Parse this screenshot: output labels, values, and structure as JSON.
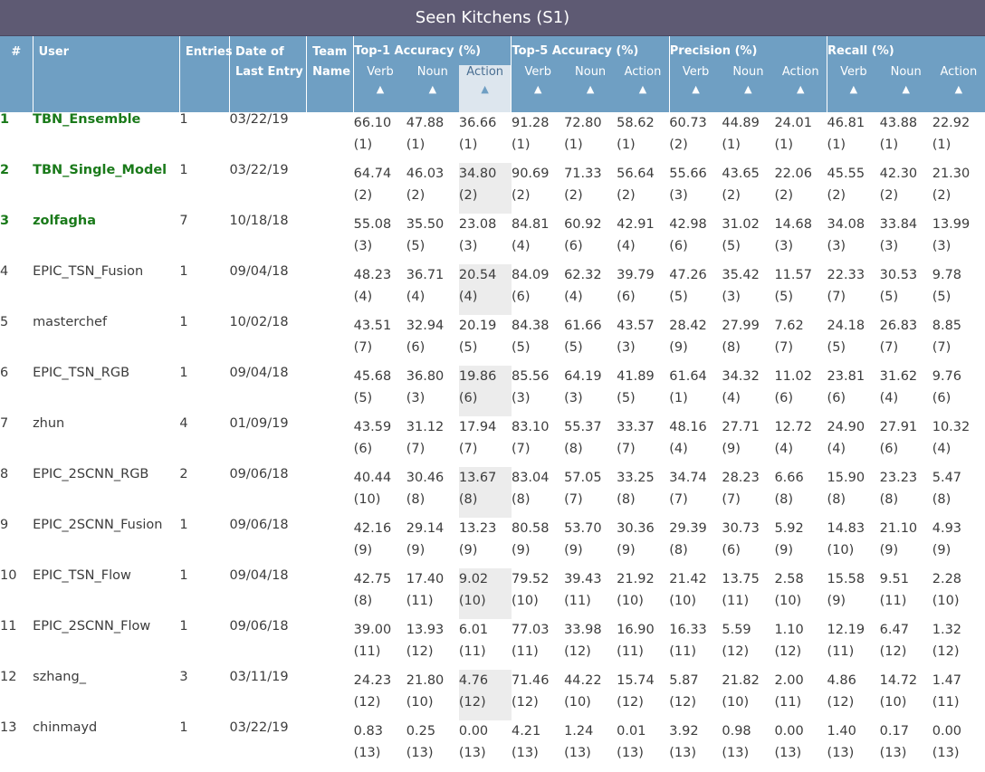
{
  "title": "Seen Kitchens (S1)",
  "colors": {
    "title_bg": "#5e5a73",
    "header_bg": "#6f9fc3",
    "top_rank": "#1a7a1a",
    "sorted_col": "#dde6ee"
  },
  "headers": {
    "rank": "#",
    "user": "User",
    "entries": "Entries",
    "date": "Date of Last Entry",
    "team": "Team Name",
    "groups": [
      "Top-1 Accuracy (%)",
      "Top-5 Accuracy (%)",
      "Precision (%)",
      "Recall (%)"
    ],
    "sub": [
      "Verb",
      "Noun",
      "Action"
    ],
    "sort_arrow": "▲"
  },
  "rows": [
    {
      "rank": "1",
      "user": "TBN_Ensemble",
      "entries": "1",
      "date": "03/22/19",
      "top": true,
      "values": [
        [
          "66.10",
          "(1)"
        ],
        [
          "47.88",
          "(1)"
        ],
        [
          "36.66",
          "(1)"
        ],
        [
          "91.28",
          "(1)"
        ],
        [
          "72.80",
          "(1)"
        ],
        [
          "58.62",
          "(1)"
        ],
        [
          "60.73",
          "(2)"
        ],
        [
          "44.89",
          "(1)"
        ],
        [
          "24.01",
          "(1)"
        ],
        [
          "46.81",
          "(1)"
        ],
        [
          "43.88",
          "(1)"
        ],
        [
          "22.92",
          "(1)"
        ]
      ]
    },
    {
      "rank": "2",
      "user": "TBN_Single_Model",
      "entries": "1",
      "date": "03/22/19",
      "top": true,
      "values": [
        [
          "64.74",
          "(2)"
        ],
        [
          "46.03",
          "(2)"
        ],
        [
          "34.80",
          "(2)"
        ],
        [
          "90.69",
          "(2)"
        ],
        [
          "71.33",
          "(2)"
        ],
        [
          "56.64",
          "(2)"
        ],
        [
          "55.66",
          "(3)"
        ],
        [
          "43.65",
          "(2)"
        ],
        [
          "22.06",
          "(2)"
        ],
        [
          "45.55",
          "(2)"
        ],
        [
          "42.30",
          "(2)"
        ],
        [
          "21.30",
          "(2)"
        ]
      ]
    },
    {
      "rank": "3",
      "user": "zolfagha",
      "entries": "7",
      "date": "10/18/18",
      "top": true,
      "values": [
        [
          "55.08",
          "(3)"
        ],
        [
          "35.50",
          "(5)"
        ],
        [
          "23.08",
          "(3)"
        ],
        [
          "84.81",
          "(4)"
        ],
        [
          "60.92",
          "(6)"
        ],
        [
          "42.91",
          "(4)"
        ],
        [
          "42.98",
          "(6)"
        ],
        [
          "31.02",
          "(5)"
        ],
        [
          "14.68",
          "(3)"
        ],
        [
          "34.08",
          "(3)"
        ],
        [
          "33.84",
          "(3)"
        ],
        [
          "13.99",
          "(3)"
        ]
      ]
    },
    {
      "rank": "4",
      "user": "EPIC_TSN_Fusion",
      "entries": "1",
      "date": "09/04/18",
      "top": false,
      "values": [
        [
          "48.23",
          "(4)"
        ],
        [
          "36.71",
          "(4)"
        ],
        [
          "20.54",
          "(4)"
        ],
        [
          "84.09",
          "(6)"
        ],
        [
          "62.32",
          "(4)"
        ],
        [
          "39.79",
          "(6)"
        ],
        [
          "47.26",
          "(5)"
        ],
        [
          "35.42",
          "(3)"
        ],
        [
          "11.57",
          "(5)"
        ],
        [
          "22.33",
          "(7)"
        ],
        [
          "30.53",
          "(5)"
        ],
        [
          "9.78",
          "(5)"
        ]
      ]
    },
    {
      "rank": "5",
      "user": "masterchef",
      "entries": "1",
      "date": "10/02/18",
      "top": false,
      "values": [
        [
          "43.51",
          "(7)"
        ],
        [
          "32.94",
          "(6)"
        ],
        [
          "20.19",
          "(5)"
        ],
        [
          "84.38",
          "(5)"
        ],
        [
          "61.66",
          "(5)"
        ],
        [
          "43.57",
          "(3)"
        ],
        [
          "28.42",
          "(9)"
        ],
        [
          "27.99",
          "(8)"
        ],
        [
          "7.62",
          "(7)"
        ],
        [
          "24.18",
          "(5)"
        ],
        [
          "26.83",
          "(7)"
        ],
        [
          "8.85",
          "(7)"
        ]
      ]
    },
    {
      "rank": "6",
      "user": "EPIC_TSN_RGB",
      "entries": "1",
      "date": "09/04/18",
      "top": false,
      "values": [
        [
          "45.68",
          "(5)"
        ],
        [
          "36.80",
          "(3)"
        ],
        [
          "19.86",
          "(6)"
        ],
        [
          "85.56",
          "(3)"
        ],
        [
          "64.19",
          "(3)"
        ],
        [
          "41.89",
          "(5)"
        ],
        [
          "61.64",
          "(1)"
        ],
        [
          "34.32",
          "(4)"
        ],
        [
          "11.02",
          "(6)"
        ],
        [
          "23.81",
          "(6)"
        ],
        [
          "31.62",
          "(4)"
        ],
        [
          "9.76",
          "(6)"
        ]
      ]
    },
    {
      "rank": "7",
      "user": "zhun",
      "entries": "4",
      "date": "01/09/19",
      "top": false,
      "values": [
        [
          "43.59",
          "(6)"
        ],
        [
          "31.12",
          "(7)"
        ],
        [
          "17.94",
          "(7)"
        ],
        [
          "83.10",
          "(7)"
        ],
        [
          "55.37",
          "(8)"
        ],
        [
          "33.37",
          "(7)"
        ],
        [
          "48.16",
          "(4)"
        ],
        [
          "27.71",
          "(9)"
        ],
        [
          "12.72",
          "(4)"
        ],
        [
          "24.90",
          "(4)"
        ],
        [
          "27.91",
          "(6)"
        ],
        [
          "10.32",
          "(4)"
        ]
      ]
    },
    {
      "rank": "8",
      "user": "EPIC_2SCNN_RGB",
      "entries": "2",
      "date": "09/06/18",
      "top": false,
      "values": [
        [
          "40.44",
          "(10)"
        ],
        [
          "30.46",
          "(8)"
        ],
        [
          "13.67",
          "(8)"
        ],
        [
          "83.04",
          "(8)"
        ],
        [
          "57.05",
          "(7)"
        ],
        [
          "33.25",
          "(8)"
        ],
        [
          "34.74",
          "(7)"
        ],
        [
          "28.23",
          "(7)"
        ],
        [
          "6.66",
          "(8)"
        ],
        [
          "15.90",
          "(8)"
        ],
        [
          "23.23",
          "(8)"
        ],
        [
          "5.47",
          "(8)"
        ]
      ]
    },
    {
      "rank": "9",
      "user": "EPIC_2SCNN_Fusion",
      "entries": "1",
      "date": "09/06/18",
      "top": false,
      "values": [
        [
          "42.16",
          "(9)"
        ],
        [
          "29.14",
          "(9)"
        ],
        [
          "13.23",
          "(9)"
        ],
        [
          "80.58",
          "(9)"
        ],
        [
          "53.70",
          "(9)"
        ],
        [
          "30.36",
          "(9)"
        ],
        [
          "29.39",
          "(8)"
        ],
        [
          "30.73",
          "(6)"
        ],
        [
          "5.92",
          "(9)"
        ],
        [
          "14.83",
          "(10)"
        ],
        [
          "21.10",
          "(9)"
        ],
        [
          "4.93",
          "(9)"
        ]
      ]
    },
    {
      "rank": "10",
      "user": "EPIC_TSN_Flow",
      "entries": "1",
      "date": "09/04/18",
      "top": false,
      "values": [
        [
          "42.75",
          "(8)"
        ],
        [
          "17.40",
          "(11)"
        ],
        [
          "9.02",
          "(10)"
        ],
        [
          "79.52",
          "(10)"
        ],
        [
          "39.43",
          "(11)"
        ],
        [
          "21.92",
          "(10)"
        ],
        [
          "21.42",
          "(10)"
        ],
        [
          "13.75",
          "(11)"
        ],
        [
          "2.58",
          "(10)"
        ],
        [
          "15.58",
          "(9)"
        ],
        [
          "9.51",
          "(11)"
        ],
        [
          "2.28",
          "(10)"
        ]
      ]
    },
    {
      "rank": "11",
      "user": "EPIC_2SCNN_Flow",
      "entries": "1",
      "date": "09/06/18",
      "top": false,
      "values": [
        [
          "39.00",
          "(11)"
        ],
        [
          "13.93",
          "(12)"
        ],
        [
          "6.01",
          "(11)"
        ],
        [
          "77.03",
          "(11)"
        ],
        [
          "33.98",
          "(12)"
        ],
        [
          "16.90",
          "(11)"
        ],
        [
          "16.33",
          "(11)"
        ],
        [
          "5.59",
          "(12)"
        ],
        [
          "1.10",
          "(12)"
        ],
        [
          "12.19",
          "(11)"
        ],
        [
          "6.47",
          "(12)"
        ],
        [
          "1.32",
          "(12)"
        ]
      ]
    },
    {
      "rank": "12",
      "user": "szhang_",
      "entries": "3",
      "date": "03/11/19",
      "top": false,
      "values": [
        [
          "24.23",
          "(12)"
        ],
        [
          "21.80",
          "(10)"
        ],
        [
          "4.76",
          "(12)"
        ],
        [
          "71.46",
          "(12)"
        ],
        [
          "44.22",
          "(10)"
        ],
        [
          "15.74",
          "(12)"
        ],
        [
          "5.87",
          "(12)"
        ],
        [
          "21.82",
          "(10)"
        ],
        [
          "2.00",
          "(11)"
        ],
        [
          "4.86",
          "(12)"
        ],
        [
          "14.72",
          "(10)"
        ],
        [
          "1.47",
          "(11)"
        ]
      ]
    },
    {
      "rank": "13",
      "user": "chinmayd",
      "entries": "1",
      "date": "03/22/19",
      "top": false,
      "values": [
        [
          "0.83",
          "(13)"
        ],
        [
          "0.25",
          "(13)"
        ],
        [
          "0.00",
          "(13)"
        ],
        [
          "4.21",
          "(13)"
        ],
        [
          "1.24",
          "(13)"
        ],
        [
          "0.01",
          "(13)"
        ],
        [
          "3.92",
          "(13)"
        ],
        [
          "0.98",
          "(13)"
        ],
        [
          "0.00",
          "(13)"
        ],
        [
          "1.40",
          "(13)"
        ],
        [
          "0.17",
          "(13)"
        ],
        [
          "0.00",
          "(13)"
        ]
      ]
    }
  ]
}
